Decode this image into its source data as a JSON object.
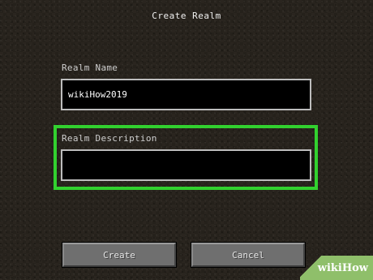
{
  "dialog": {
    "title": "Create Realm"
  },
  "form": {
    "name": {
      "label": "Realm Name",
      "value": "wikiHow2019"
    },
    "description": {
      "label": "Realm Description",
      "value": ""
    }
  },
  "buttons": {
    "create_label": "Create",
    "cancel_label": "Cancel"
  },
  "colors": {
    "highlight": "#32d12f",
    "button_bg": "#6f6f6f",
    "field_bg": "#000000"
  },
  "watermark": {
    "text": "wikiHow"
  }
}
